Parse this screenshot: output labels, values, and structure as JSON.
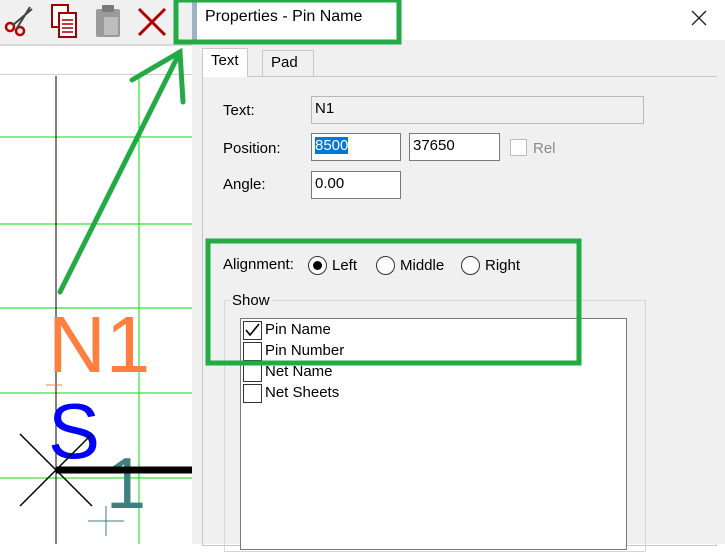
{
  "colors": {
    "grid": "#00dd00",
    "annotation": "#22aa44",
    "pin_name": "#ff7f3f",
    "pin_number": "#0000ff",
    "net": "#3f7f7f",
    "selection": "#0078d7"
  },
  "canvas": {
    "pin_name_label": "N1",
    "pin_number_label": "S",
    "net_label": "1",
    "toolbar_icons": [
      "scissors-icon",
      "copy-icon",
      "paste-icon",
      "delete-icon"
    ]
  },
  "dialog": {
    "title": "Properties - Pin Name",
    "tabs": [
      "Text",
      "Pad"
    ],
    "active_tab": "Text",
    "text": {
      "label": "Text:",
      "value": "N1"
    },
    "position": {
      "label": "Position:",
      "x": "8500",
      "y": "37650",
      "rel_label": "Rel",
      "rel_checked": false
    },
    "angle": {
      "label": "Angle:",
      "value": "0.00"
    },
    "alignment": {
      "label": "Alignment:",
      "options": [
        "Left",
        "Middle",
        "Right"
      ],
      "selected": "Left"
    },
    "show": {
      "label": "Show",
      "items": [
        {
          "label": "Pin Name",
          "checked": true
        },
        {
          "label": "Pin Number",
          "checked": false
        },
        {
          "label": "Net Name",
          "checked": false
        },
        {
          "label": "Net Sheets",
          "checked": false
        }
      ]
    }
  }
}
